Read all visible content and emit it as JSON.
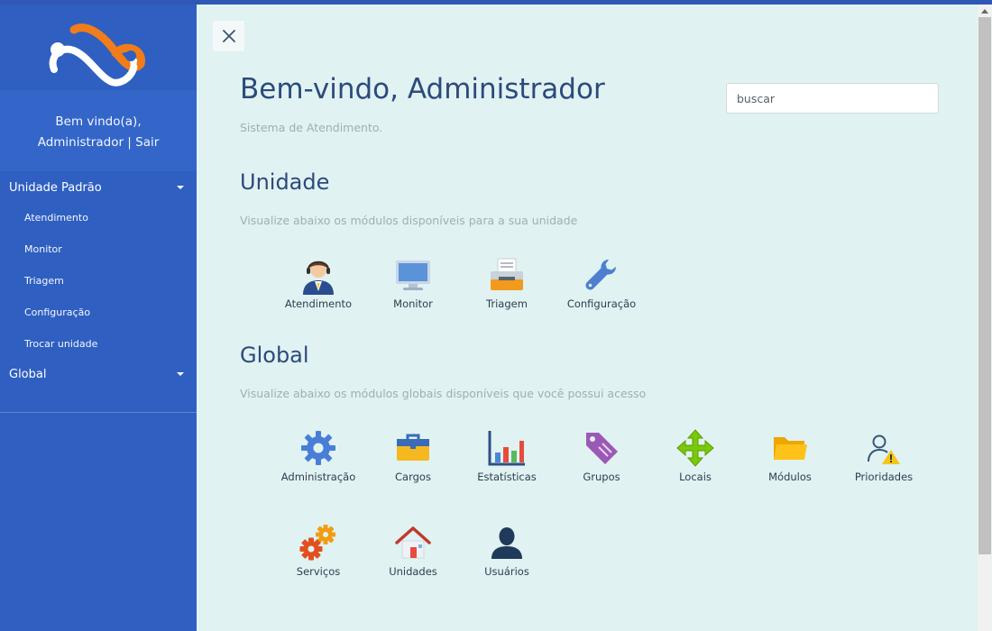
{
  "sidebar": {
    "welcome_line1": "Bem vindo(a),",
    "welcome_line2": "Administrador | Sair",
    "groups": [
      {
        "label": "Unidade Padrão",
        "items": [
          "Atendimento",
          "Monitor",
          "Triagem",
          "Configuração",
          "Trocar unidade"
        ]
      },
      {
        "label": "Global",
        "items": []
      }
    ]
  },
  "main": {
    "title": "Bem-vindo, Administrador",
    "subtitle": "Sistema de Atendimento.",
    "search": {
      "placeholder": "buscar",
      "value": ""
    },
    "unidade": {
      "title": "Unidade",
      "description": "Visualize abaixo os módulos disponíveis para a sua unidade",
      "modules": [
        "Atendimento",
        "Monitor",
        "Triagem",
        "Configuração"
      ]
    },
    "global": {
      "title": "Global",
      "description": "Visualize abaixo os módulos globais disponíveis que você possui acesso",
      "modules": [
        "Administração",
        "Cargos",
        "Estatísticas",
        "Grupos",
        "Locais",
        "Módulos",
        "Prioridades",
        "Serviços",
        "Unidades",
        "Usuários"
      ]
    }
  },
  "icons": {
    "close": "close-icon",
    "atendimento": "attendant-icon",
    "monitor": "monitor-icon",
    "triagem": "printer-icon",
    "configuracao": "wrench-icon",
    "administracao": "gear-icon",
    "cargos": "briefcase-icon",
    "estatisticas": "bar-chart-icon",
    "grupos": "tag-icon",
    "locais": "move-arrows-icon",
    "modulos": "folder-icon",
    "prioridades": "user-warning-icon",
    "servicos": "gears-icon",
    "unidades": "house-icon",
    "usuarios": "user-silhouette-icon"
  },
  "colors": {
    "sidebar": "#2f5fc0",
    "welcome_band": "#3366c8",
    "background": "#e0f2f2",
    "title": "#2d4a7c",
    "muted": "#9db0b4",
    "logo_orange": "#f07d1a"
  }
}
